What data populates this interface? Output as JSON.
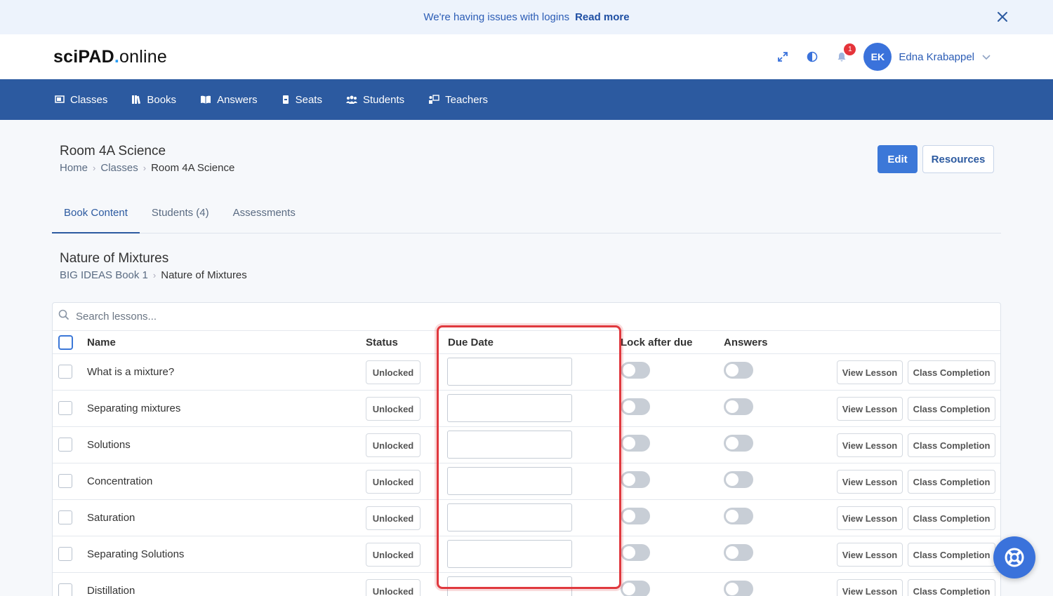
{
  "banner": {
    "message": "We're having issues with logins",
    "link": "Read more"
  },
  "header": {
    "logo_sci": "sciPAD",
    "logo_dot": ".",
    "logo_online": "online",
    "notification_count": "1",
    "avatar_initials": "EK",
    "username": "Edna Krabappel"
  },
  "nav": {
    "items": [
      {
        "label": "Classes",
        "icon": "classroom-icon"
      },
      {
        "label": "Books",
        "icon": "books-icon"
      },
      {
        "label": "Answers",
        "icon": "open-book-icon"
      },
      {
        "label": "Seats",
        "icon": "seat-icon"
      },
      {
        "label": "Students",
        "icon": "students-icon"
      },
      {
        "label": "Teachers",
        "icon": "teacher-icon"
      }
    ]
  },
  "page": {
    "title": "Room 4A Science",
    "breadcrumb": [
      "Home",
      "Classes",
      "Room 4A Science"
    ],
    "edit_label": "Edit",
    "resources_label": "Resources"
  },
  "tabs": [
    {
      "label": "Book Content",
      "active": true
    },
    {
      "label": "Students (4)",
      "active": false
    },
    {
      "label": "Assessments",
      "active": false
    }
  ],
  "section": {
    "title": "Nature of Mixtures",
    "breadcrumb": [
      "BIG IDEAS Book 1",
      "Nature of Mixtures"
    ]
  },
  "table": {
    "search_placeholder": "Search lessons...",
    "headers": {
      "name": "Name",
      "status": "Status",
      "due_date": "Due Date",
      "lock": "Lock after due",
      "answers": "Answers"
    },
    "view_label": "View Lesson",
    "completion_label": "Class Completion",
    "rows": [
      {
        "name": "What is a mixture?",
        "status": "Unlocked",
        "due_date": "",
        "lock": false,
        "answers": false
      },
      {
        "name": "Separating mixtures",
        "status": "Unlocked",
        "due_date": "",
        "lock": false,
        "answers": false
      },
      {
        "name": "Solutions",
        "status": "Unlocked",
        "due_date": "",
        "lock": false,
        "answers": false
      },
      {
        "name": "Concentration",
        "status": "Unlocked",
        "due_date": "",
        "lock": false,
        "answers": false
      },
      {
        "name": "Saturation",
        "status": "Unlocked",
        "due_date": "",
        "lock": false,
        "answers": false
      },
      {
        "name": "Separating Solutions",
        "status": "Unlocked",
        "due_date": "",
        "lock": false,
        "answers": false
      },
      {
        "name": "Distillation",
        "status": "Unlocked",
        "due_date": "",
        "lock": false,
        "answers": false
      }
    ]
  },
  "colors": {
    "accent": "#3c78d8",
    "nav_bg": "#2c5aa0",
    "highlight": "#e0393e",
    "banner_bg": "#edf3fc"
  }
}
